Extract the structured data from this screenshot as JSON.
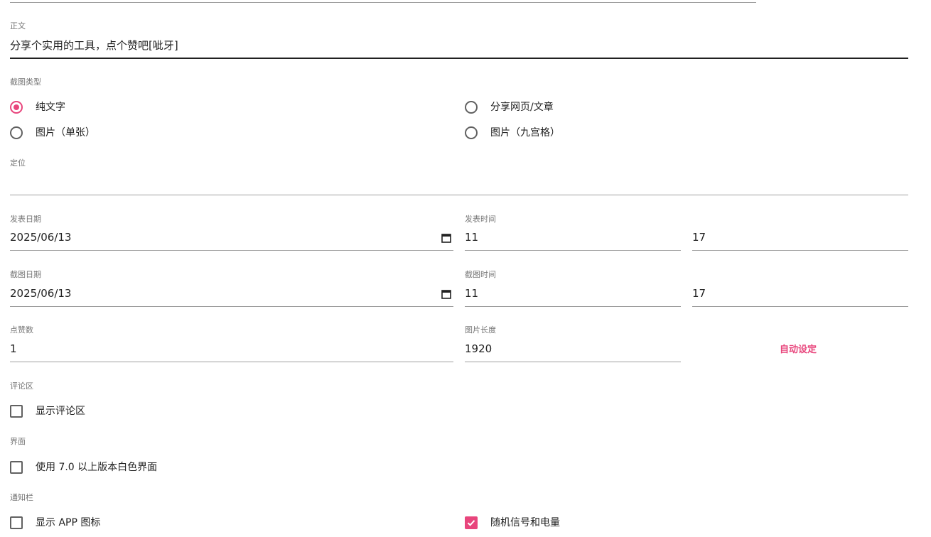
{
  "body_section": {
    "label": "正文",
    "value": "分享个实用的工具，点个赞吧[呲牙]"
  },
  "screenshot_type": {
    "label": "截图类型",
    "options": [
      "纯文字",
      "分享网页/文章",
      "图片（单张）",
      "图片（九宫格）"
    ],
    "selected": "纯文字"
  },
  "location": {
    "label": "定位",
    "value": ""
  },
  "publish": {
    "date_label": "发表日期",
    "date_value": "2025/06/13",
    "time_label": "发表时间",
    "hour": "11",
    "minute": "17"
  },
  "capture": {
    "date_label": "截图日期",
    "date_value": "2025/06/13",
    "time_label": "截图时间",
    "hour": "11",
    "minute": "17"
  },
  "likes": {
    "label": "点赞数",
    "value": "1"
  },
  "image_length": {
    "label": "图片长度",
    "value": "1920",
    "auto_button": "自动设定"
  },
  "comments": {
    "label": "评论区",
    "checkbox": "显示评论区",
    "checked": false
  },
  "interface": {
    "label": "界面",
    "checkbox": "使用 7.0 以上版本白色界面",
    "checked": false
  },
  "notification": {
    "label": "通知栏",
    "show_app_icon": "显示 APP 图标",
    "show_app_icon_checked": false,
    "random_signal": "随机信号和电量",
    "random_signal_checked": true
  },
  "colors": {
    "accent": "#e8457c"
  }
}
